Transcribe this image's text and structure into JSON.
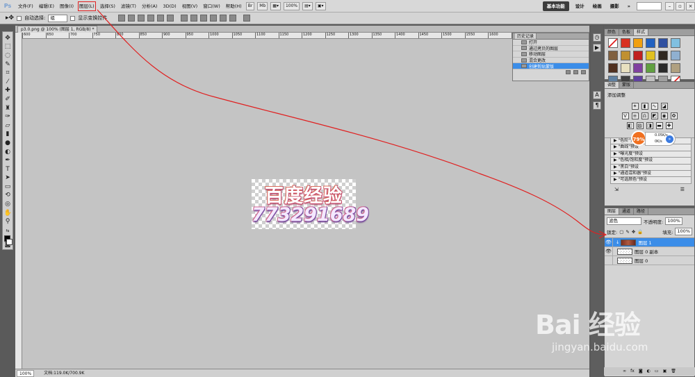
{
  "menubar": {
    "app_logo": "Ps",
    "items": [
      "文件(F)",
      "编辑(E)",
      "图像(I)",
      "图层(L)",
      "选择(S)",
      "滤镜(T)",
      "分析(A)",
      "3D(D)",
      "视图(V)",
      "窗口(W)",
      "帮助(H)"
    ],
    "highlighted_item": "图层(L)",
    "zoom": "100%",
    "workspaces": [
      "基本功能",
      "设计",
      "绘画",
      "摄影"
    ],
    "active_workspace": "基本功能"
  },
  "options": {
    "auto_select_label": "自动选择:",
    "auto_select_value": "组",
    "transform_controls_label": "显示变换控件"
  },
  "document": {
    "tab_title": "p3.0.png @ 100% (图层 1, RGB/8) *",
    "ruler_ticks": [
      "600",
      "650",
      "700",
      "750",
      "800",
      "850",
      "900",
      "950",
      "1000",
      "1050",
      "1100",
      "1150",
      "1200",
      "1250",
      "1300",
      "1350",
      "1400",
      "1450",
      "1500",
      "1550",
      "1600",
      "1650"
    ],
    "image_line1": "百度经验",
    "image_line2": "773291689"
  },
  "statusbar": {
    "zoom": "100%",
    "doc_size": "文档:119.0K/700.9K"
  },
  "history": {
    "title": "历史记录",
    "items": [
      "打开",
      "通过拷贝的图层",
      "移动图层",
      "混合更改",
      "创建剪贴蒙版"
    ],
    "active_index": 4
  },
  "styles_panel": {
    "tabs": [
      "颜色",
      "色板",
      "样式"
    ],
    "active_tab": "样式",
    "swatch_colors": [
      "#ffffff",
      "#d83020",
      "#f0a010",
      "#2060c0",
      "#3050a0",
      "#80c0e0",
      "#806040",
      "#c09030",
      "#c02020",
      "#e0c020",
      "#302820",
      "#90b0d0",
      "#503020",
      "#e8e0c0",
      "#8040a0",
      "#60a040",
      "#2a2a2a",
      "#b0a080",
      "#6080a0",
      "#404040",
      "#6040a0",
      "#c0c0c0",
      "#a0a0a0",
      "#ffffff"
    ]
  },
  "adjustments_panel": {
    "tabs": [
      "调整",
      "蒙版"
    ],
    "active_tab": "调整",
    "title": "添加调整",
    "presets": [
      "\"色阶\"预设",
      "\"曲线\"预设",
      "\"曝光度\"预设",
      "\"色相/饱和度\"预设",
      "\"黑白\"预设",
      "\"通道混和器\"预设",
      "\"可选颜色\"预设"
    ]
  },
  "net_widget": {
    "percent": "79%",
    "up": "0.05K/s",
    "down": "0K/s"
  },
  "layers_panel": {
    "tabs": [
      "图层",
      "通道",
      "路径"
    ],
    "active_tab": "图层",
    "blend_mode": "滤色",
    "opacity_label": "不透明度:",
    "opacity_value": "100%",
    "lock_label": "锁定:",
    "fill_label": "填充:",
    "fill_value": "100%",
    "layers": [
      {
        "name": "图层 1",
        "active": true
      },
      {
        "name": "图层 0 副本",
        "active": false
      },
      {
        "name": "图层 0",
        "active": false
      }
    ]
  },
  "watermark": {
    "logo_text": "Bai 经验",
    "url": "jingyan.baidu.com"
  }
}
